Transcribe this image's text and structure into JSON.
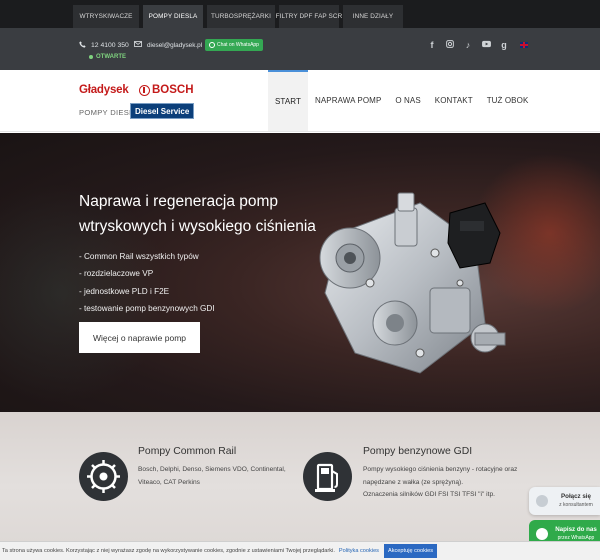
{
  "top_tabs": [
    {
      "label": "WTRYSKIWACZE"
    },
    {
      "label": "POMPY DIESLA"
    },
    {
      "label": "TURBOSPRĘŻARKI"
    },
    {
      "label": "FILTRY DPF FAP SCR"
    },
    {
      "label": "INNE DZIAŁY"
    }
  ],
  "active_tab": "POMPY DIESLA",
  "infobar": {
    "phone": "12 4100 350",
    "open_status": "OTWARTE",
    "email": "diesel@gladysek.pl",
    "whatsapp_label": "Chat on WhatsApp",
    "social_icons": [
      "facebook-icon",
      "instagram-icon",
      "tiktok-icon",
      "youtube-icon",
      "google-icon",
      "uk-flag-icon"
    ]
  },
  "header": {
    "logo_gladysek": "Gładysek",
    "logo_bosch": "BOSCH",
    "logo_subtitle": "POMPY DIESLA",
    "logo_badge": "Diesel Service",
    "nav": [
      {
        "label": "START"
      },
      {
        "label": "NAPRAWA POMP"
      },
      {
        "label": "O NAS"
      },
      {
        "label": "KONTAKT"
      },
      {
        "label": "TUŻ OBOK"
      }
    ],
    "active_nav": "START"
  },
  "hero": {
    "heading": "Naprawa i regeneracja pomp wtryskowych i wysokiego ciśnienia",
    "bullets": [
      "- Common Rail wszystkich typów",
      "- rozdzielaczowe VP",
      "- jednostkowe PLD i F2E",
      "- testowanie pomp benzynowych GDI"
    ],
    "cta_label": "Więcej o naprawie pomp"
  },
  "services": [
    {
      "icon": "injection-pump-icon",
      "title": "Pompy Common Rail",
      "lines": [
        "Bosch, Delphi, Denso, Siemens VDO, Continental,",
        "Viteaco, CAT Perkins"
      ]
    },
    {
      "icon": "gasoline-pump-icon",
      "title": "Pompy benzynowe GDI",
      "lines": [
        "Pompy wysokiego ciśnienia benzyny - rotacyjne oraz",
        "napędzane z wałka (ze sprężyną).",
        "Oznaczenia silników GDI FSI TSI TFSI \"i\" itp."
      ]
    }
  ],
  "float_buttons": {
    "call_title": "Połącz się",
    "call_sub": "z konsultantem",
    "wa_title": "Napisz do nas",
    "wa_sub": "przez WhatsApp"
  },
  "cookie": {
    "message": "Ta strona używa cookies. Korzystając z niej wyrażasz zgodę na wykorzystywanie cookies, zgodnie z ustawieniami Twojej przeglądarki.",
    "policy_link": "Polityka cookies",
    "accept_label": "Akceptuję cookies"
  },
  "colors": {
    "topbar": "#1b1c1e",
    "infobar": "#3a3d41",
    "accent_red": "#c41a1a",
    "diesel_blue": "#0b3f7a",
    "whatsapp_green": "#34a853",
    "link_blue": "#2565b5"
  }
}
